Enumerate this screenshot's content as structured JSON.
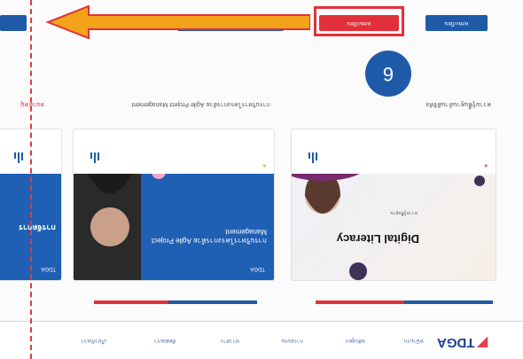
{
  "nav": {
    "logo": "TDGA",
    "items": [
      "หน้าแรก",
      "หลักสูตร",
      "การอบรม",
      "ข่าวสาร",
      "ติดต่อเรา",
      "เกี่ยวกับเรา"
    ]
  },
  "courses": [
    {
      "title": "Digital Literacy",
      "subtitle": "ความรู้พื้นฐาน",
      "label": "ความรู้พื้นฐานด้านดิจิทัล"
    },
    {
      "title": "การบริหารโครงการด้วย Agile Project Management",
      "badge": "TDGA",
      "label": "การบริหารโครงการด้วย Agile Project Management"
    },
    {
      "title": "การจัดการ",
      "badge": "TDGA",
      "label": "การจัดการ"
    }
  ],
  "callout": {
    "number": "6"
  },
  "buttons": {
    "primary": "ลงทะเบียน",
    "secondary": "ลงทะเบียน"
  },
  "sidebar_label": "หมวดหมู่",
  "colors": {
    "brand": "#1e5aa8",
    "accent": "#e63b4a",
    "highlight": "#e2303b",
    "arrow": "#f2a31a"
  }
}
